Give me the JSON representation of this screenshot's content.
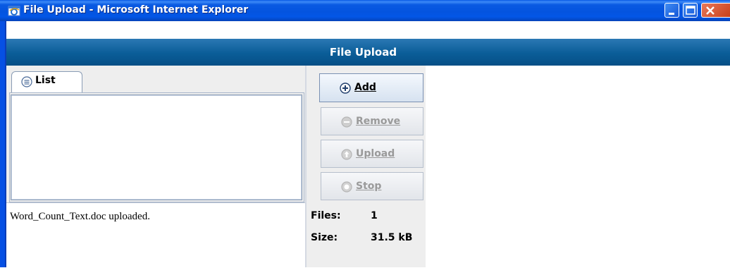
{
  "window": {
    "title": "File Upload - Microsoft Internet Explorer",
    "icon": "ie-icon"
  },
  "app": {
    "header_title": "File Upload"
  },
  "tabs": [
    {
      "label": "List",
      "icon": "list-icon",
      "selected": true
    }
  ],
  "list": {
    "items": []
  },
  "status": {
    "message": "Word_Count_Text.doc uploaded."
  },
  "controls": {
    "add_label": "Add",
    "remove_label": "Remove",
    "upload_label": "Upload",
    "stop_label": "Stop"
  },
  "stats": {
    "files_label": "Files:",
    "files_value": "1",
    "size_label": "Size:",
    "size_value": "31.5 kB"
  },
  "colors": {
    "titlebar": "#0454df",
    "header": "#0a5d98",
    "panel": "#eeeeee",
    "disabled_text": "#9a9a9a"
  }
}
